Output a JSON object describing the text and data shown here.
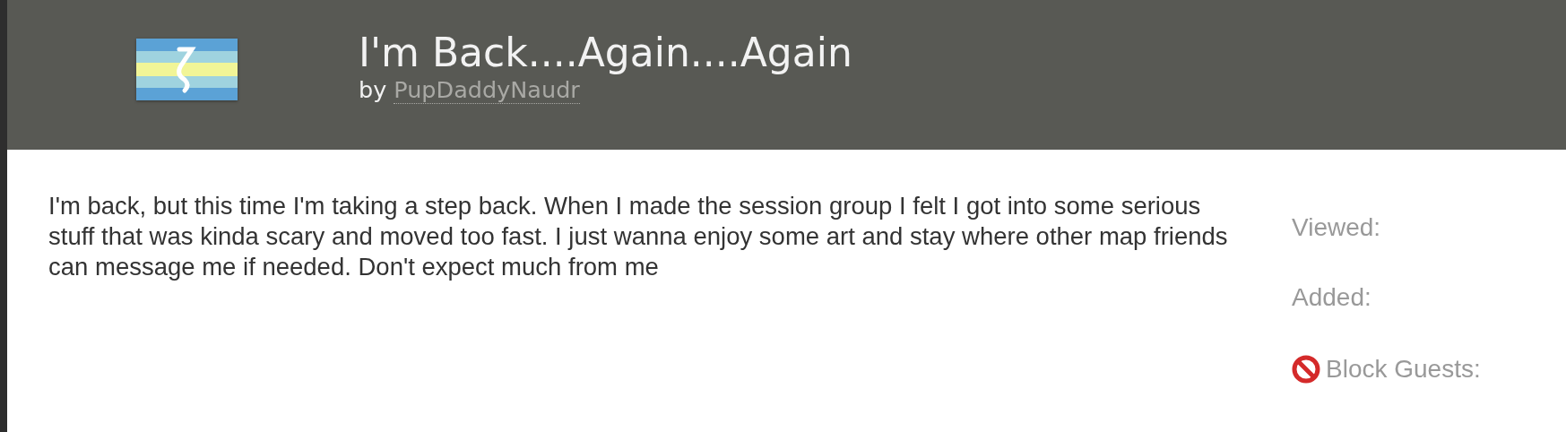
{
  "header": {
    "title": "I'm Back....Again....Again",
    "byline": {
      "prefix": "by",
      "author": "PupDaddyNaudr"
    }
  },
  "body": "I'm back, but this time I'm taking a step back. When I made the session group I felt I got into some serious stuff that was kinda scary and moved too fast. I just wanna enjoy some art and stay where other map friends can message me if needed. Don't expect much from me",
  "details": [
    {
      "kind": "plain",
      "label": "Viewed:"
    },
    {
      "kind": "plain",
      "label": "Added:"
    },
    {
      "kind": "blocked",
      "label": "Block Guests:"
    }
  ]
}
